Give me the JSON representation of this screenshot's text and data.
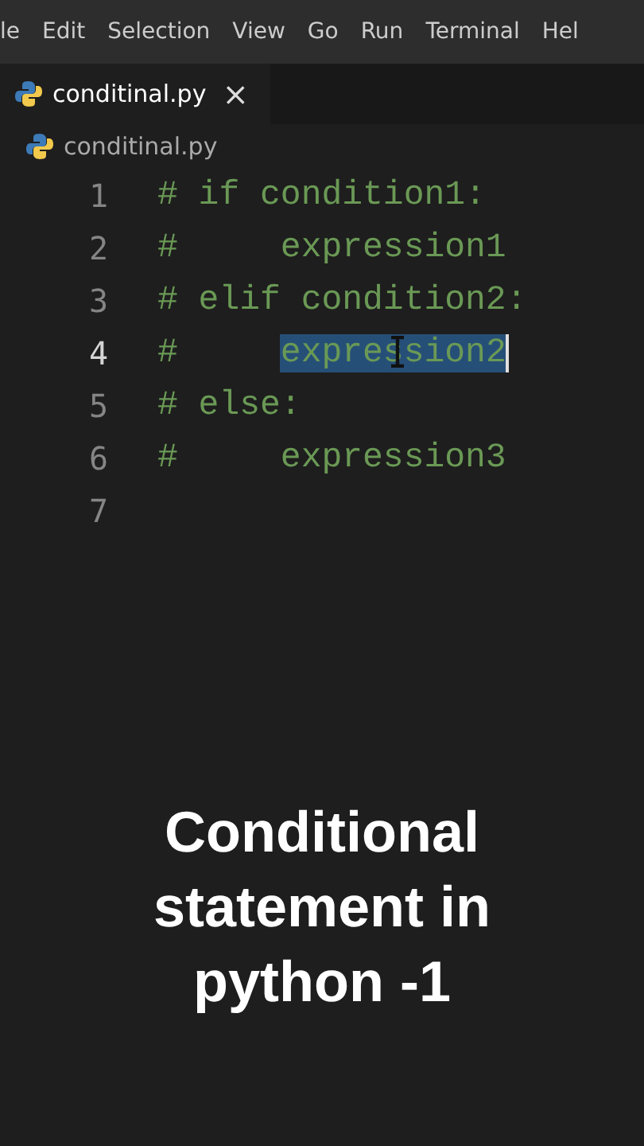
{
  "menu_bar": {
    "items": [
      "le",
      "Edit",
      "Selection",
      "View",
      "Go",
      "Run",
      "Terminal",
      "Hel"
    ]
  },
  "tabs": [
    {
      "label": "conditinal.py",
      "close": "×",
      "selected": true
    }
  ],
  "breadcrumb": {
    "label": "conditinal.py"
  },
  "editor": {
    "lines": [
      {
        "number": "1",
        "current": false,
        "segments": [
          {
            "text": "# if condition1:",
            "selected": false
          }
        ]
      },
      {
        "number": "2",
        "current": false,
        "segments": [
          {
            "text": "#     expression1",
            "selected": false
          }
        ]
      },
      {
        "number": "3",
        "current": false,
        "segments": [
          {
            "text": "# elif condition2:",
            "selected": false
          }
        ]
      },
      {
        "number": "4",
        "current": true,
        "segments": [
          {
            "text": "#     ",
            "selected": false
          },
          {
            "text": "expression2",
            "selected": true
          }
        ]
      },
      {
        "number": "5",
        "current": false,
        "segments": [
          {
            "text": "# else:",
            "selected": false
          }
        ]
      },
      {
        "number": "6",
        "current": false,
        "segments": [
          {
            "text": "#     expression3",
            "selected": false
          }
        ]
      },
      {
        "number": "7",
        "current": false
      }
    ]
  },
  "caption": "Conditional statement in python -1"
}
